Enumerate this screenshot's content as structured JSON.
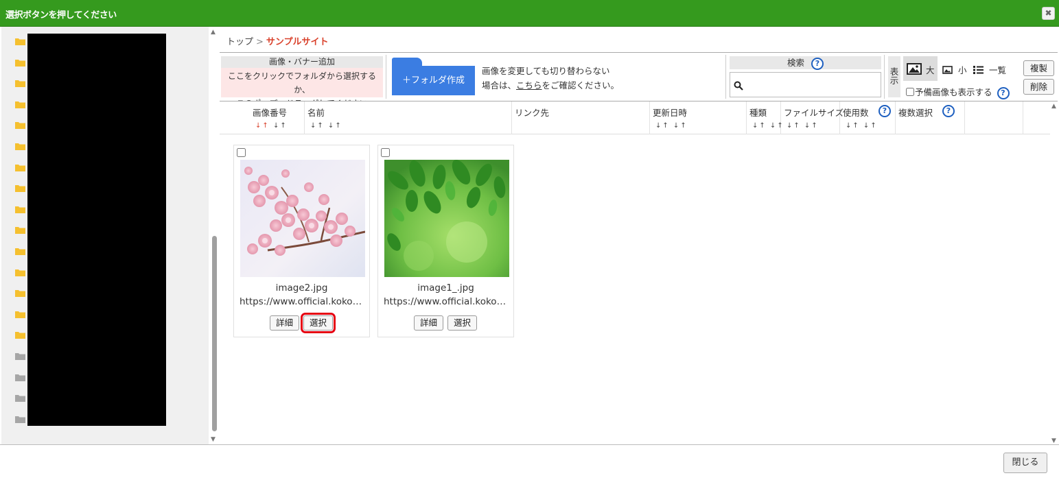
{
  "window": {
    "title": "選択ボタンを押してください",
    "close_glyph": "✖"
  },
  "breadcrumb": {
    "root": "トップ",
    "separator": ">",
    "current": "サンプルサイト"
  },
  "toolbar": {
    "add_title": "画像・バナー追加",
    "drop_line1": "ここをクリックでフォルダから選択するか、",
    "drop_line2": "このポップへドラッグしてください",
    "folder_button": "＋フォルダ作成",
    "note_line1": "画像を変更しても切り替わらない",
    "note_prefix": "場合は、",
    "note_link": "こちら",
    "note_suffix": "をご確認ください。",
    "search_title": "検索",
    "display_label": "表示",
    "view_large": "大",
    "view_small": "小",
    "view_list": "一覧",
    "spare_label": "予備画像も表示する",
    "copy_button": "複製",
    "delete_button": "削除",
    "help_glyph": "?"
  },
  "columns": [
    {
      "label": "画像番号",
      "sortable": true
    },
    {
      "label": "名前",
      "sortable": true
    },
    {
      "label": "リンク先",
      "sortable": false
    },
    {
      "label": "更新日時",
      "sortable": true
    },
    {
      "label": "種類",
      "sortable": true
    },
    {
      "label": "ファイルサイズ",
      "sortable": true
    },
    {
      "label": "使用数",
      "sortable": true
    },
    {
      "label": "複数選択",
      "sortable": false
    }
  ],
  "images": [
    {
      "name": "image2.jpg",
      "url": "https://www.official.kokoro-support.jp/",
      "detail": "詳細",
      "select": "選択"
    },
    {
      "name": "image1_.jpg",
      "url": "https://www.official.kokoro-support.jp/",
      "detail": "詳細",
      "select": "選択"
    }
  ],
  "footer": {
    "close_button": "閉じる"
  },
  "colors": {
    "titlebar": "#359a1e",
    "accent_red": "#d9412b",
    "folder_blue": "#3b7de2",
    "folder_yellow": "#f5c02f",
    "folder_gray": "#a6a6a6",
    "highlight": "#e60012"
  }
}
